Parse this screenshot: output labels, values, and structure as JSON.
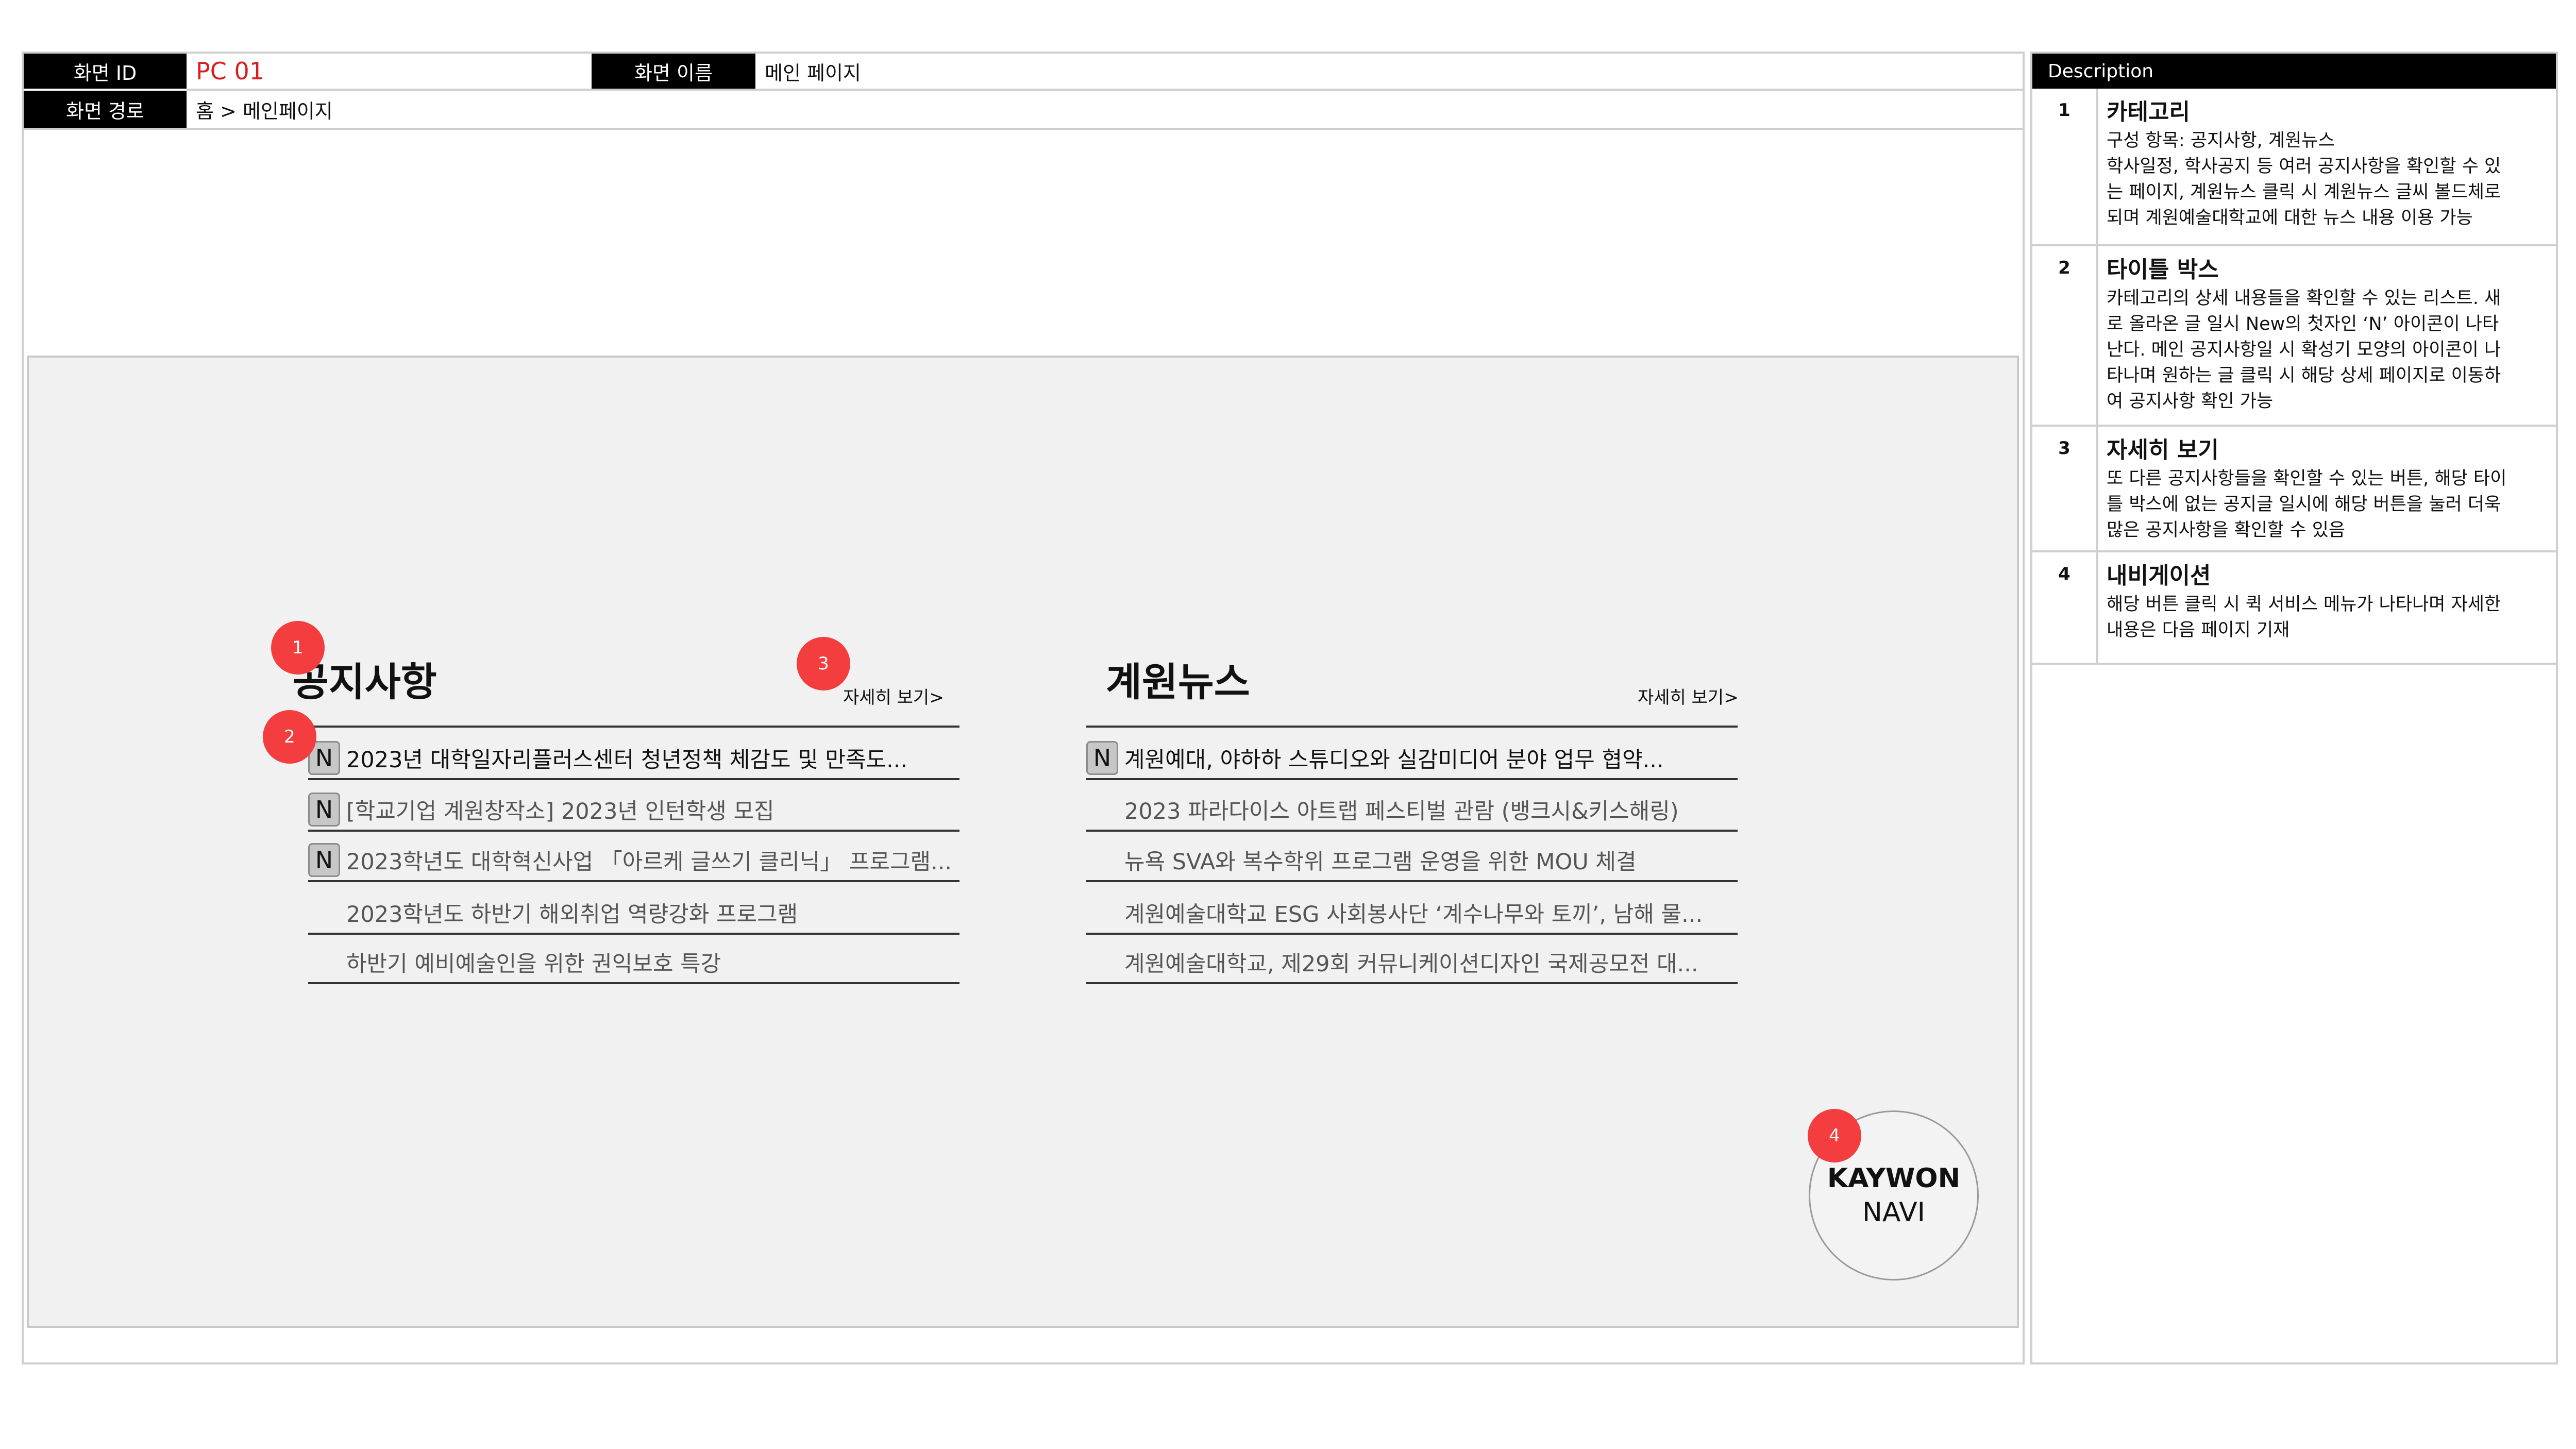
{
  "header": {
    "screen_id_label": "화면 ID",
    "screen_id_value": "PC 01",
    "screen_name_label": "화면 이름",
    "screen_name_value": "메인 페이지",
    "screen_path_label": "화면 경로",
    "screen_path_value": "홈 > 메인페이지"
  },
  "notice": {
    "title": "공지사항",
    "more": "자세히 보기>",
    "items": [
      {
        "text": "2023년 대학일자리플러스센터 청년정책 체감도 및 만족도...",
        "badge": "N"
      },
      {
        "text": "[학교기업 계원창작소] 2023년 인턴학생 모집",
        "badge": "N"
      },
      {
        "text": "2023학년도 대학혁신사업 「아르케 글쓰기 클리닉」 프로그램...",
        "badge": "N"
      },
      {
        "text": "2023학년도 하반기 해외취업 역량강화 프로그램",
        "badge": ""
      },
      {
        "text": "하반기 예비예술인을 위한 권익보호 특강",
        "badge": ""
      }
    ]
  },
  "news": {
    "title": "계원뉴스",
    "more": "자세히 보기>",
    "items": [
      {
        "text": "계원예대, 야하하 스튜디오와 실감미디어 분야 업무 협약...",
        "badge": "N"
      },
      {
        "text": "2023 파라다이스 아트랩 페스티벌 관람 (뱅크시&키스해링)",
        "badge": ""
      },
      {
        "text": "뉴욕 SVA와 복수학위 프로그램 운영을 위한 MOU 체결",
        "badge": ""
      },
      {
        "text": "계원예술대학교 ESG 사회봉사단 ‘계수나무와 토끼’, 남해 물...",
        "badge": ""
      },
      {
        "text": "계원예술대학교, 제29회 커뮤니케이션디자인 국제공모전 대...",
        "badge": ""
      }
    ]
  },
  "markers": [
    "1",
    "2",
    "3",
    "4"
  ],
  "navi": {
    "line1": "KAYWON",
    "line2": "NAVI"
  },
  "description": {
    "header": "Description",
    "rows": [
      {
        "num": "1",
        "title": "카테고리",
        "lines": [
          "구성 항목: 공지사항, 계원뉴스",
          "학사일정, 학사공지 등 여러 공지사항을 확인할 수 있",
          "는 페이지, 계원뉴스 클릭 시 계원뉴스 글씨 볼드체로",
          "되며 계원예술대학교에 대한 뉴스 내용 이용 가능"
        ]
      },
      {
        "num": "2",
        "title": "타이틀 박스",
        "lines": [
          "카테고리의 상세 내용들을 확인할 수 있는 리스트. 새",
          "로 올라온 글 일시 New의 첫자인 ‘N’ 아이콘이 나타",
          "난다. 메인 공지사항일 시 확성기 모양의 아이콘이 나",
          "타나며  원하는 글 클릭 시 해당 상세 페이지로 이동하",
          "여 공지사항 확인 가능"
        ]
      },
      {
        "num": "3",
        "title": "자세히 보기",
        "lines": [
          "또 다른 공지사항들을 확인할 수 있는 버튼, 해당 타이",
          "틀 박스에 없는 공지글 일시에 해당 버튼을 눌러 더욱",
          "많은 공지사항을 확인할 수 있음"
        ]
      },
      {
        "num": "4",
        "title": "내비게이션",
        "lines": [
          "해당 버튼 클릭 시 퀵 서비스 메뉴가 나타나며 자세한",
          "내용은 다음 페이지 기재"
        ]
      }
    ]
  },
  "colors": {
    "marker": "#f33d3f",
    "screen_id": "#d81f1f",
    "canvas": "#f1f1f1"
  }
}
